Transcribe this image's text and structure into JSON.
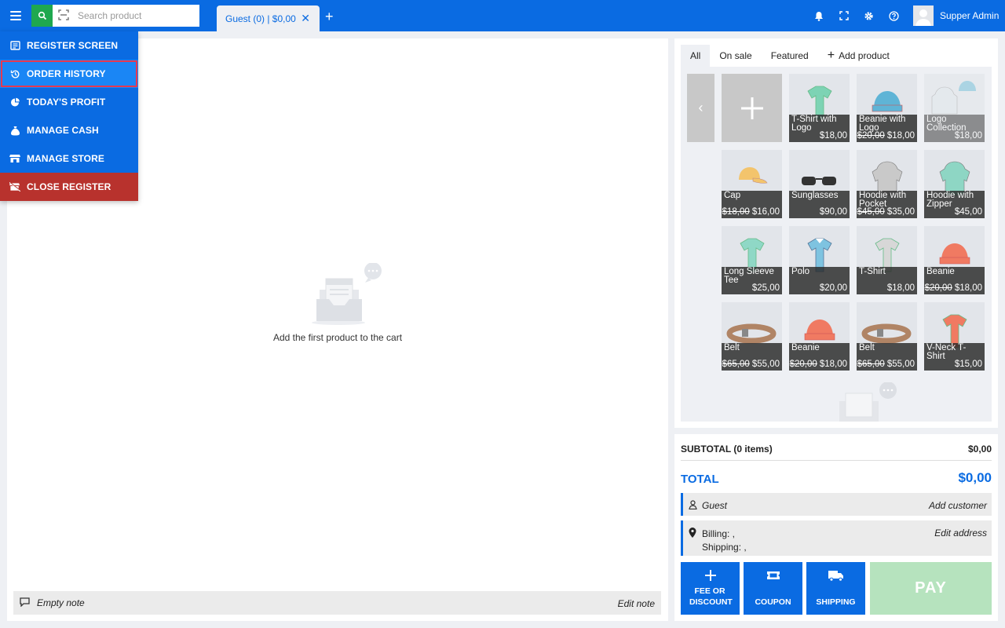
{
  "topbar": {
    "search_placeholder": "Search product",
    "cart_tab_label": "Guest (0) | $0,00",
    "cart_tab_close": "✕",
    "add_tab": "+",
    "user_name": "Supper Admin"
  },
  "menu": {
    "items": [
      {
        "label": "REGISTER SCREEN",
        "icon": "register-icon"
      },
      {
        "label": "ORDER HISTORY",
        "icon": "history-icon"
      },
      {
        "label": "TODAY'S PROFIT",
        "icon": "pie-chart-icon"
      },
      {
        "label": "MANAGE CASH",
        "icon": "money-bag-icon"
      },
      {
        "label": "MANAGE STORE",
        "icon": "store-icon"
      },
      {
        "label": "CLOSE REGISTER",
        "icon": "store-closed-icon"
      }
    ]
  },
  "cart": {
    "empty_message": "Add the first product to the cart",
    "note_placeholder": "Empty note",
    "edit_note": "Edit note"
  },
  "products": {
    "tabs": [
      "All",
      "On sale",
      "Featured",
      "Add product"
    ],
    "items": [
      {
        "name": "T-Shirt with Logo",
        "price": "$18,00",
        "old_price": ""
      },
      {
        "name": "Beanie with Logo",
        "price": "$18,00",
        "old_price": "$20,00"
      },
      {
        "name": "Logo Collection",
        "price": "$18,00",
        "old_price": ""
      },
      {
        "name": "Cap",
        "price": "$16,00",
        "old_price": "$18,00"
      },
      {
        "name": "Sunglasses",
        "price": "$90,00",
        "old_price": ""
      },
      {
        "name": "Hoodie with Pocket",
        "price": "$35,00",
        "old_price": "$45,00"
      },
      {
        "name": "Hoodie with Zipper",
        "price": "$45,00",
        "old_price": ""
      },
      {
        "name": "Long Sleeve Tee",
        "price": "$25,00",
        "old_price": ""
      },
      {
        "name": "Polo",
        "price": "$20,00",
        "old_price": ""
      },
      {
        "name": "T-Shirt",
        "price": "$18,00",
        "old_price": ""
      },
      {
        "name": "Beanie",
        "price": "$18,00",
        "old_price": "$20,00"
      },
      {
        "name": "Belt",
        "price": "$55,00",
        "old_price": "$65,00"
      },
      {
        "name": "Beanie",
        "price": "$18,00",
        "old_price": "$20,00"
      },
      {
        "name": "Belt",
        "price": "$55,00",
        "old_price": "$65,00"
      },
      {
        "name": "V-Neck T-Shirt",
        "price": "$15,00",
        "old_price": ""
      }
    ]
  },
  "totals": {
    "subtotal_label": "SUBTOTAL (0 items)",
    "subtotal_value": "$0,00",
    "total_label": "TOTAL",
    "total_value": "$0,00",
    "customer": "Guest",
    "add_customer": "Add customer",
    "billing": "Billing: ,",
    "shipping": "Shipping: ,",
    "edit_address": "Edit address",
    "fee_button": "FEE OR DISCOUNT",
    "coupon_button": "COUPON",
    "shipping_button": "SHIPPING",
    "pay_button": "PAY"
  },
  "colors": {
    "primary": "#0a6be2",
    "search_green": "#1fa84f",
    "danger": "#b8322d",
    "pay_disabled": "#b6e3be"
  }
}
